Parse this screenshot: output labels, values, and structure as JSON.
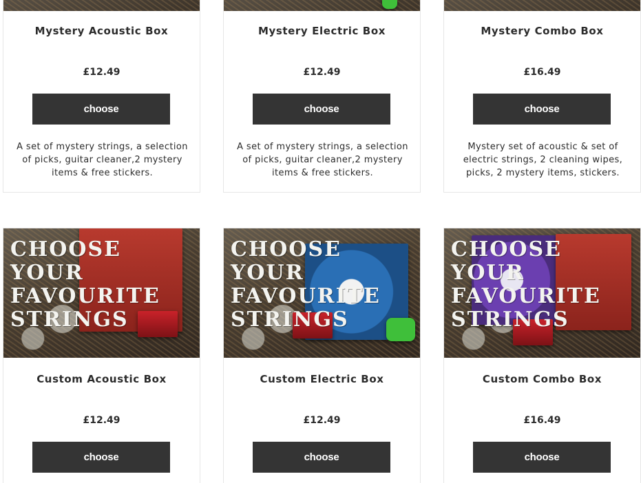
{
  "choose_label": "choose",
  "row1": [
    {
      "title": "Mystery Acoustic Box",
      "price": "£12.49",
      "description": "A set of mystery strings, a selection of picks, guitar cleaner,2 mystery items & free stickers."
    },
    {
      "title": "Mystery Electric Box",
      "price": "£12.49",
      "description": "A set of mystery strings, a selection of picks, guitar cleaner,2 mystery items & free stickers."
    },
    {
      "title": "Mystery Combo Box",
      "price": "£16.49",
      "description": "Mystery set of acoustic & set of electric strings, 2 cleaning wipes, picks, 2 mystery items, stickers."
    }
  ],
  "row2": [
    {
      "title": "Custom Acoustic Box",
      "price": "£12.49",
      "image_text": "CHOOSE\nYOUR\nFAVOURITE\nSTRINGS"
    },
    {
      "title": "Custom Electric Box",
      "price": "£12.49",
      "image_text": "CHOOSE\nYOUR\nFAVOURITE\nSTRINGS"
    },
    {
      "title": "Custom Combo Box",
      "price": "£16.49",
      "image_text": "CHOOSE\nYOUR\nFAVOURITE\nSTRINGS"
    }
  ],
  "colors": {
    "button_bg": "#343434",
    "button_text": "#ffffff",
    "text": "#2b2b2b",
    "border": "#e6e6e6"
  }
}
